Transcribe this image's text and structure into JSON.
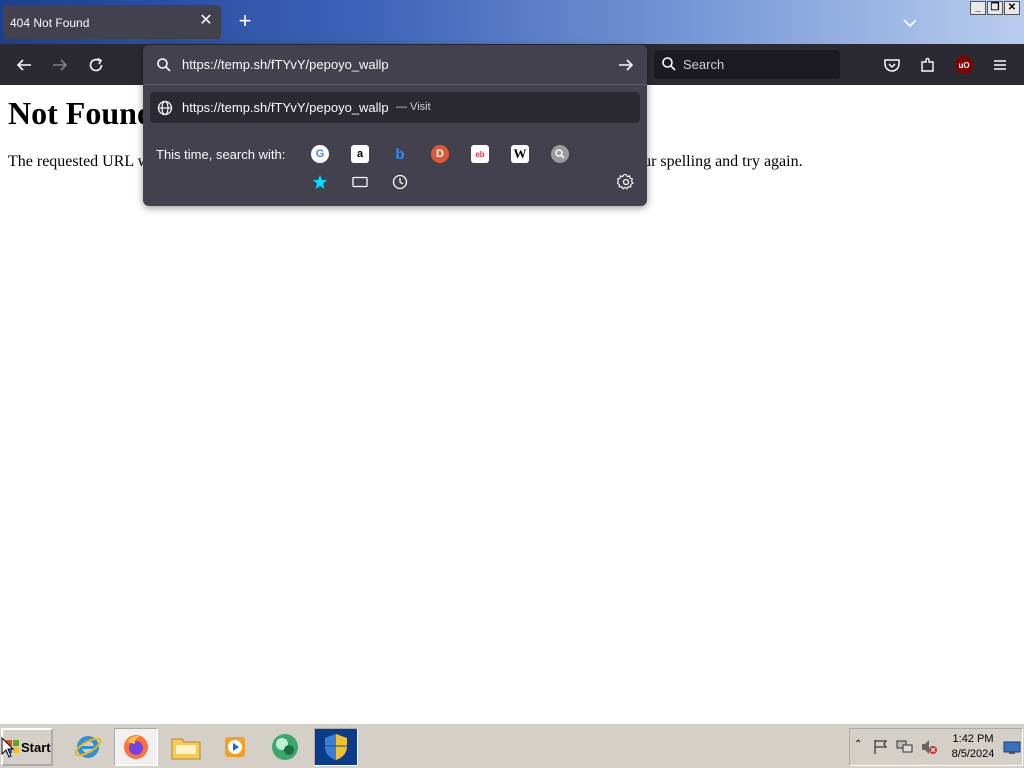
{
  "browser": {
    "tab": {
      "title": "404 Not Found",
      "close": "✕"
    },
    "new_tab": "+",
    "window_controls": [
      "_",
      "❐",
      "✕"
    ],
    "nav": {
      "search_placeholder": "Search",
      "extension_badge": "uO"
    },
    "url_dropdown": {
      "input_value": "https://temp.sh/fTYvY/pepoyo_wallp",
      "suggestion": {
        "url": "https://temp.sh/fTYvY/pepoyo_wallp",
        "action": "— Visit"
      },
      "search_with_label": "This time, search with:",
      "engines": [
        "google",
        "amazon",
        "bing",
        "duckduckgo",
        "ebay",
        "wikipedia",
        "search",
        "bookmarks",
        "tabs",
        "history"
      ]
    }
  },
  "page": {
    "heading": "Not Found",
    "message": "The requested URL was not found on this server. If you entered the URL manually please check your spelling and try again."
  },
  "taskbar": {
    "start_label": "Start",
    "pinned": [
      "internet-explorer",
      "firefox",
      "file-explorer",
      "media-player",
      "chat-app",
      "security-shield"
    ],
    "clock": {
      "time": "1:42 PM",
      "date": "8/5/2024"
    }
  },
  "colors": {
    "toolbar": "#2b2a33",
    "dropdown": "#42414d",
    "taskbar": "#d4d0c8"
  }
}
